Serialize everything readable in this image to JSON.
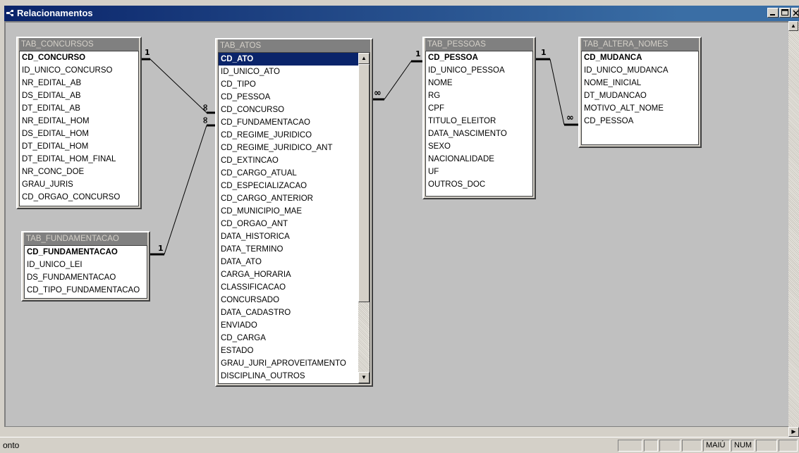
{
  "window": {
    "title": "Relacionamentos",
    "buttons": [
      "minimize",
      "maximize",
      "close"
    ]
  },
  "tables": {
    "concursos": {
      "name": "TAB_CONCURSOS",
      "fields": [
        "CD_CONCURSO",
        "ID_UNICO_CONCURSO",
        "NR_EDITAL_AB",
        "DS_EDITAL_AB",
        "DT_EDITAL_AB",
        "NR_EDITAL_HOM",
        "DS_EDITAL_HOM",
        "DT_EDITAL_HOM",
        "DT_EDITAL_HOM_FINAL",
        "NR_CONC_DOE",
        "GRAU_JURIS",
        "CD_ORGAO_CONCURSO"
      ],
      "primary_key": "CD_CONCURSO"
    },
    "fundamentacao": {
      "name": "TAB_FUNDAMENTACAO",
      "fields": [
        "CD_FUNDAMENTACAO",
        "ID_UNICO_LEI",
        "DS_FUNDAMENTACAO",
        "CD_TIPO_FUNDAMENTACAO"
      ],
      "primary_key": "CD_FUNDAMENTACAO"
    },
    "atos": {
      "name": "TAB_ATOS",
      "fields": [
        "CD_ATO",
        "ID_UNICO_ATO",
        "CD_TIPO",
        "CD_PESSOA",
        "CD_CONCURSO",
        "CD_FUNDAMENTACAO",
        "CD_REGIME_JURIDICO",
        "CD_REGIME_JURIDICO_ANT",
        "CD_EXTINCAO",
        "CD_CARGO_ATUAL",
        "CD_ESPECIALIZACAO",
        "CD_CARGO_ANTERIOR",
        "CD_MUNICIPIO_MAE",
        "CD_ORGAO_ANT",
        "DATA_HISTORICA",
        "DATA_TERMINO",
        "DATA_ATO",
        "CARGA_HORARIA",
        "CLASSIFICACAO",
        "CONCURSADO",
        "DATA_CADASTRO",
        "ENVIADO",
        "CD_CARGA",
        "ESTADO",
        "GRAU_JURI_APROVEITAMENTO",
        "DISCIPLINA_OUTROS"
      ],
      "primary_key": "CD_ATO",
      "selected_field": "CD_ATO",
      "has_scrollbar": true
    },
    "pessoas": {
      "name": "TAB_PESSOAS",
      "fields": [
        "CD_PESSOA",
        "ID_UNICO_PESSOA",
        "NOME",
        "RG",
        "CPF",
        "TITULO_ELEITOR",
        "DATA_NASCIMENTO",
        "SEXO",
        "NACIONALIDADE",
        "UF",
        "OUTROS_DOC"
      ],
      "primary_key": "CD_PESSOA"
    },
    "altera_nomes": {
      "name": "TAB_ALTERA_NOMES",
      "fields": [
        "CD_MUDANCA",
        "ID_UNICO_MUDANCA",
        "NOME_INICIAL",
        "DT_MUDANCAO",
        "MOTIVO_ALT_NOME",
        "CD_PESSOA"
      ],
      "primary_key": "CD_MUDANCA"
    }
  },
  "relationships": [
    {
      "from": "TAB_CONCURSOS",
      "to": "TAB_ATOS",
      "one": "1",
      "many": "∞"
    },
    {
      "from": "TAB_FUNDAMENTACAO",
      "to": "TAB_ATOS",
      "one": "1",
      "many": "∞"
    },
    {
      "from": "TAB_PESSOAS",
      "to": "TAB_ATOS",
      "one": "1",
      "many": "∞"
    },
    {
      "from": "TAB_PESSOAS",
      "to": "TAB_ALTERA_NOMES",
      "one": "1",
      "many": "∞"
    }
  ],
  "statusbar": {
    "text": "onto",
    "caps": "MAIÚ",
    "num": "NUM"
  },
  "colors": {
    "title_active": "#0a246a",
    "canvas": "#c0c0c0",
    "table_title_inactive": "#808080",
    "selection": "#0a246a"
  }
}
